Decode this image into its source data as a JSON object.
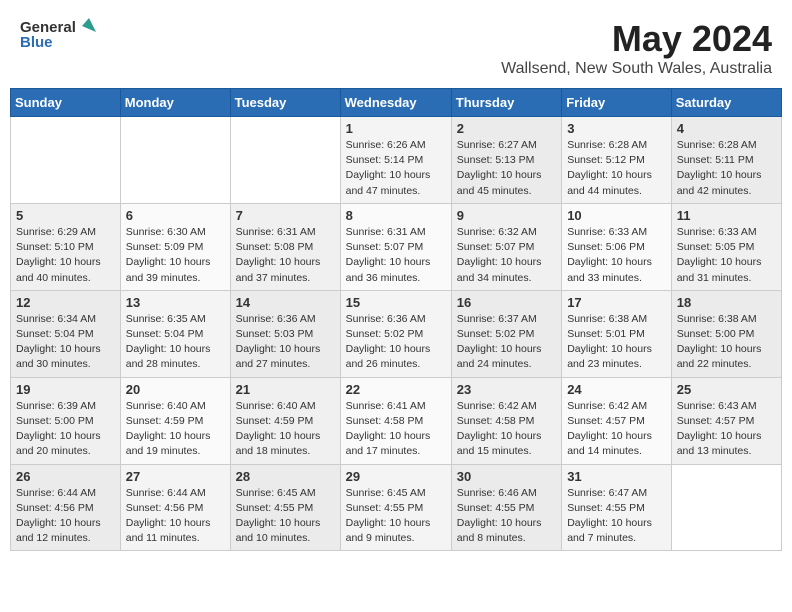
{
  "header": {
    "logo_general": "General",
    "logo_blue": "Blue",
    "title": "May 2024",
    "subtitle": "Wallsend, New South Wales, Australia"
  },
  "days_of_week": [
    "Sunday",
    "Monday",
    "Tuesday",
    "Wednesday",
    "Thursday",
    "Friday",
    "Saturday"
  ],
  "weeks": [
    [
      {
        "day": "",
        "info": ""
      },
      {
        "day": "",
        "info": ""
      },
      {
        "day": "",
        "info": ""
      },
      {
        "day": "1",
        "info": "Sunrise: 6:26 AM\nSunset: 5:14 PM\nDaylight: 10 hours\nand 47 minutes."
      },
      {
        "day": "2",
        "info": "Sunrise: 6:27 AM\nSunset: 5:13 PM\nDaylight: 10 hours\nand 45 minutes."
      },
      {
        "day": "3",
        "info": "Sunrise: 6:28 AM\nSunset: 5:12 PM\nDaylight: 10 hours\nand 44 minutes."
      },
      {
        "day": "4",
        "info": "Sunrise: 6:28 AM\nSunset: 5:11 PM\nDaylight: 10 hours\nand 42 minutes."
      }
    ],
    [
      {
        "day": "5",
        "info": "Sunrise: 6:29 AM\nSunset: 5:10 PM\nDaylight: 10 hours\nand 40 minutes."
      },
      {
        "day": "6",
        "info": "Sunrise: 6:30 AM\nSunset: 5:09 PM\nDaylight: 10 hours\nand 39 minutes."
      },
      {
        "day": "7",
        "info": "Sunrise: 6:31 AM\nSunset: 5:08 PM\nDaylight: 10 hours\nand 37 minutes."
      },
      {
        "day": "8",
        "info": "Sunrise: 6:31 AM\nSunset: 5:07 PM\nDaylight: 10 hours\nand 36 minutes."
      },
      {
        "day": "9",
        "info": "Sunrise: 6:32 AM\nSunset: 5:07 PM\nDaylight: 10 hours\nand 34 minutes."
      },
      {
        "day": "10",
        "info": "Sunrise: 6:33 AM\nSunset: 5:06 PM\nDaylight: 10 hours\nand 33 minutes."
      },
      {
        "day": "11",
        "info": "Sunrise: 6:33 AM\nSunset: 5:05 PM\nDaylight: 10 hours\nand 31 minutes."
      }
    ],
    [
      {
        "day": "12",
        "info": "Sunrise: 6:34 AM\nSunset: 5:04 PM\nDaylight: 10 hours\nand 30 minutes."
      },
      {
        "day": "13",
        "info": "Sunrise: 6:35 AM\nSunset: 5:04 PM\nDaylight: 10 hours\nand 28 minutes."
      },
      {
        "day": "14",
        "info": "Sunrise: 6:36 AM\nSunset: 5:03 PM\nDaylight: 10 hours\nand 27 minutes."
      },
      {
        "day": "15",
        "info": "Sunrise: 6:36 AM\nSunset: 5:02 PM\nDaylight: 10 hours\nand 26 minutes."
      },
      {
        "day": "16",
        "info": "Sunrise: 6:37 AM\nSunset: 5:02 PM\nDaylight: 10 hours\nand 24 minutes."
      },
      {
        "day": "17",
        "info": "Sunrise: 6:38 AM\nSunset: 5:01 PM\nDaylight: 10 hours\nand 23 minutes."
      },
      {
        "day": "18",
        "info": "Sunrise: 6:38 AM\nSunset: 5:00 PM\nDaylight: 10 hours\nand 22 minutes."
      }
    ],
    [
      {
        "day": "19",
        "info": "Sunrise: 6:39 AM\nSunset: 5:00 PM\nDaylight: 10 hours\nand 20 minutes."
      },
      {
        "day": "20",
        "info": "Sunrise: 6:40 AM\nSunset: 4:59 PM\nDaylight: 10 hours\nand 19 minutes."
      },
      {
        "day": "21",
        "info": "Sunrise: 6:40 AM\nSunset: 4:59 PM\nDaylight: 10 hours\nand 18 minutes."
      },
      {
        "day": "22",
        "info": "Sunrise: 6:41 AM\nSunset: 4:58 PM\nDaylight: 10 hours\nand 17 minutes."
      },
      {
        "day": "23",
        "info": "Sunrise: 6:42 AM\nSunset: 4:58 PM\nDaylight: 10 hours\nand 15 minutes."
      },
      {
        "day": "24",
        "info": "Sunrise: 6:42 AM\nSunset: 4:57 PM\nDaylight: 10 hours\nand 14 minutes."
      },
      {
        "day": "25",
        "info": "Sunrise: 6:43 AM\nSunset: 4:57 PM\nDaylight: 10 hours\nand 13 minutes."
      }
    ],
    [
      {
        "day": "26",
        "info": "Sunrise: 6:44 AM\nSunset: 4:56 PM\nDaylight: 10 hours\nand 12 minutes."
      },
      {
        "day": "27",
        "info": "Sunrise: 6:44 AM\nSunset: 4:56 PM\nDaylight: 10 hours\nand 11 minutes."
      },
      {
        "day": "28",
        "info": "Sunrise: 6:45 AM\nSunset: 4:55 PM\nDaylight: 10 hours\nand 10 minutes."
      },
      {
        "day": "29",
        "info": "Sunrise: 6:45 AM\nSunset: 4:55 PM\nDaylight: 10 hours\nand 9 minutes."
      },
      {
        "day": "30",
        "info": "Sunrise: 6:46 AM\nSunset: 4:55 PM\nDaylight: 10 hours\nand 8 minutes."
      },
      {
        "day": "31",
        "info": "Sunrise: 6:47 AM\nSunset: 4:55 PM\nDaylight: 10 hours\nand 7 minutes."
      },
      {
        "day": "",
        "info": ""
      }
    ]
  ]
}
